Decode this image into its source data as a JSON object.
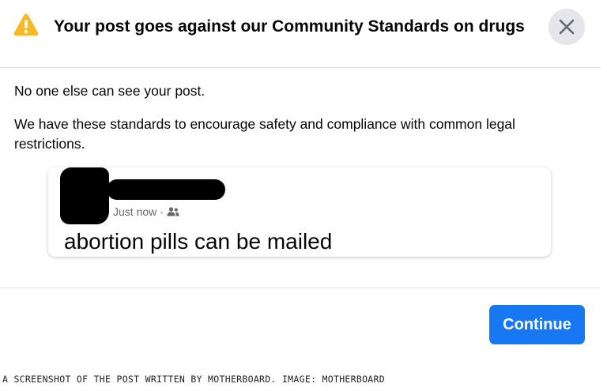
{
  "dialog": {
    "title": "Your post goes against our Community Standards on drugs",
    "warning_icon": "warning-triangle-icon",
    "close_icon": "close-icon",
    "paragraph1": "No one else can see your post.",
    "paragraph2": "We have these standards to encourage safety and compliance with common legal restrictions.",
    "continue_label": "Continue",
    "accent_color": "#1877f2",
    "warning_color": "#f7b928"
  },
  "post": {
    "timestamp": "Just now",
    "separator": "·",
    "audience_icon": "friends-icon",
    "text": "abortion pills can be mailed"
  },
  "caption": "A SCREENSHOT OF THE POST WRITTEN BY MOTHERBOARD. IMAGE: MOTHERBOARD"
}
